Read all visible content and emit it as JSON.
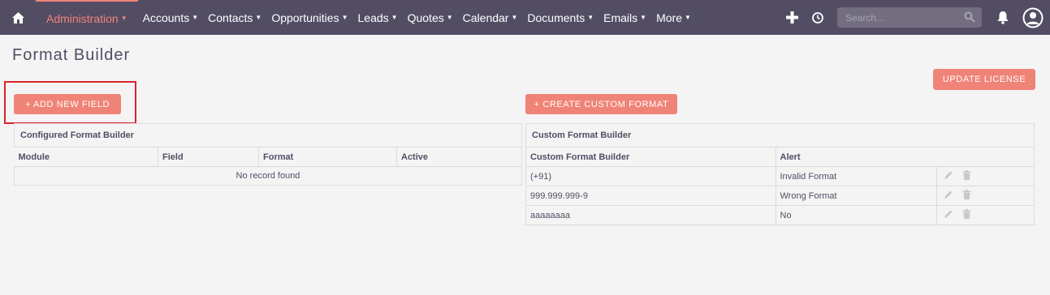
{
  "nav": {
    "items": [
      {
        "label": "Administration",
        "name": "nav-administration",
        "active": true
      },
      {
        "label": "Accounts",
        "name": "nav-accounts"
      },
      {
        "label": "Contacts",
        "name": "nav-contacts"
      },
      {
        "label": "Opportunities",
        "name": "nav-opportunities"
      },
      {
        "label": "Leads",
        "name": "nav-leads"
      },
      {
        "label": "Quotes",
        "name": "nav-quotes"
      },
      {
        "label": "Calendar",
        "name": "nav-calendar"
      },
      {
        "label": "Documents",
        "name": "nav-documents"
      },
      {
        "label": "Emails",
        "name": "nav-emails"
      },
      {
        "label": "More",
        "name": "nav-more"
      }
    ],
    "search_placeholder": "Search...",
    "icons": [
      "home-icon",
      "plus-icon",
      "history-icon",
      "search-icon",
      "bell-icon",
      "user-avatar-icon"
    ]
  },
  "page": {
    "title": "Format Builder",
    "update_license_label": "UPDATE LICENSE",
    "add_field_label": "+ ADD NEW FIELD",
    "create_custom_label": "+ CREATE CUSTOM FORMAT"
  },
  "configured_table": {
    "caption": "Configured Format Builder",
    "columns": [
      "Module",
      "Field",
      "Format",
      "Active"
    ],
    "empty_text": "No record found"
  },
  "custom_table": {
    "caption": "Custom Format Builder",
    "columns": [
      "Custom Format Builder",
      "Alert"
    ],
    "rows": [
      {
        "format": "(+91)",
        "alert": "Invalid Format"
      },
      {
        "format": "999.999.999-9",
        "alert": "Wrong Format"
      },
      {
        "format": "aaaaaaaa",
        "alert": "No"
      }
    ]
  },
  "colors": {
    "nav_bg": "#534d64",
    "accent": "#f08377",
    "highlight_border": "#d9252a"
  }
}
